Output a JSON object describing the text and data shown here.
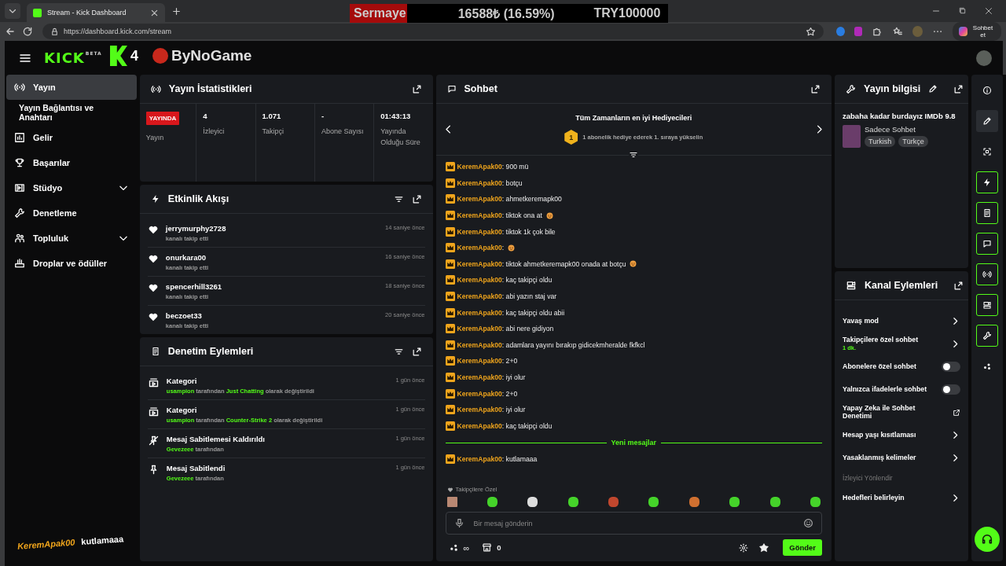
{
  "browser": {
    "tab_title": "Stream - Kick Dashboard",
    "url": "https://dashboard.kick.com/stream",
    "copilot_label": "Sohbet et"
  },
  "overlay": {
    "capital_label": "Sermaye",
    "capital_value": "16588₺ (16.59%)",
    "capital_target": "TRY100000",
    "level": 0.18,
    "logo_number": "4",
    "logo_text": "ByNoGame",
    "chat_user": "KeremApak00",
    "chat_text": "kutlamaaa"
  },
  "header": {
    "logo": "KICK",
    "logo_badge": "BETA"
  },
  "sidebar": {
    "items": [
      {
        "label": "Yayın",
        "kind": "broadcast",
        "selected": true,
        "expandable": false
      },
      {
        "label": "Yayın Bağlantısı ve Anahtarı",
        "kind": "subitem",
        "selected": false,
        "expandable": false
      },
      {
        "label": "Gelir",
        "kind": "chart",
        "selected": false,
        "expandable": false
      },
      {
        "label": "Başarılar",
        "kind": "trophy",
        "selected": false,
        "expandable": false
      },
      {
        "label": "Stüdyo",
        "kind": "film",
        "selected": false,
        "expandable": true
      },
      {
        "label": "Denetleme",
        "kind": "wrench",
        "selected": false,
        "expandable": false
      },
      {
        "label": "Topluluk",
        "kind": "people",
        "selected": false,
        "expandable": true
      },
      {
        "label": "Droplar ve ödüller",
        "kind": "gift",
        "selected": false,
        "expandable": false
      }
    ]
  },
  "stats": {
    "title": "Yayın İstatistikleri",
    "live_badge": "YAYINDA",
    "live_label": "Yayın",
    "items": [
      {
        "value": "4",
        "label": "İzleyici"
      },
      {
        "value": "1.071",
        "label": "Takipçi"
      },
      {
        "value": "-",
        "label": "Abone Sayısı"
      },
      {
        "value": "01:43:13",
        "label": "Yayında Olduğu Süre"
      }
    ]
  },
  "activity": {
    "title": "Etkinlik Akışı",
    "items": [
      {
        "user": "jerrymurphy2728",
        "action": "kanalı takip etti",
        "time": "14 saniye önce"
      },
      {
        "user": "onurkara00",
        "action": "kanalı takip etti",
        "time": "16 saniye önce"
      },
      {
        "user": "spencerhill3261",
        "action": "kanalı takip etti",
        "time": "18 saniye önce"
      },
      {
        "user": "beczoet33",
        "action": "kanalı takip etti",
        "time": "20 saniye önce"
      }
    ]
  },
  "moderation": {
    "title": "Denetim Eylemleri",
    "items": [
      {
        "kind": "category",
        "title": "Kategori",
        "detail": "**usampion** tarafından **Just Chatting** olarak değiştirildi",
        "time": "1 gün önce"
      },
      {
        "kind": "category",
        "title": "Kategori",
        "detail": "**usampion** tarafından **Counter-Strike 2** olarak değiştirildi",
        "time": "1 gün önce"
      },
      {
        "kind": "unpin",
        "title": "Mesaj Sabitlemesi Kaldırıldı",
        "detail": "**Gevezeee** tarafından",
        "time": "1 gün önce"
      },
      {
        "kind": "pin",
        "title": "Mesaj Sabitlendi",
        "detail": "**Gevezeee** tarafından",
        "time": "1 gün önce"
      }
    ]
  },
  "chat": {
    "title": "Sohbet",
    "gifters_title": "Tüm Zamanların en iyi Hediyecileri",
    "gift_rank": "1",
    "gift_prompt": "1 abonelik hediye ederek 1. sıraya yükselin",
    "messages": [
      {
        "text": "**KeremApak00**: 900 mü",
        "emoji": false
      },
      {
        "text": "**KeremApak00**: botçu",
        "emoji": false
      },
      {
        "text": "**KeremApak00**: ahmetkeremapk00",
        "emoji": false
      },
      {
        "text": "**KeremApak00**: tiktok ona at",
        "emoji": true
      },
      {
        "text": "**KeremApak00**: tiktok 1k çok bile",
        "emoji": false
      },
      {
        "text": "**KeremApak00**:",
        "emoji": true
      },
      {
        "text": "**KeremApak00**: tiktok ahmetkeremapk00 onada at botçu",
        "emoji": true
      },
      {
        "text": "**KeremApak00**: kaç takipçi oldu",
        "emoji": false
      },
      {
        "text": "**KeremApak00**: abi yazın staj var",
        "emoji": false
      },
      {
        "text": "**KeremApak00**: kaç takipçi oldu abii",
        "emoji": false
      },
      {
        "text": "**KeremApak00**: abi nere gidiyon",
        "emoji": false
      },
      {
        "text": "**KeremApak00**: adamlara yayını bırakıp gidicekmheralde fkfkcl",
        "emoji": false
      },
      {
        "text": "**KeremApak00**: 2+0",
        "emoji": false
      },
      {
        "text": "**KeremApak00**: iyi olur",
        "emoji": false
      },
      {
        "text": "**KeremApak00**: 2+0",
        "emoji": false
      },
      {
        "text": "**KeremApak00**: iyi olur",
        "emoji": false
      },
      {
        "text": "**KeremApak00**: kaç takipçi oldu",
        "emoji": false
      }
    ],
    "new_label": "Yeni mesajlar",
    "new_messages": [
      {
        "text": "**KeremApak00**: kutlamaaa",
        "emoji": false
      }
    ],
    "emote_group": "Takipçilere Özel",
    "placeholder": "Bir mesaj gönderin",
    "points": "∞",
    "shop_count": "0",
    "send": "Gönder"
  },
  "stream_info": {
    "title": "Yayın bilgisi",
    "stream_title": "zabaha kadar burdayız IMDb 9.8",
    "category": "Sadece Sohbet",
    "tags": [
      "Turkish",
      "Türkçe"
    ]
  },
  "channel_actions": {
    "title": "Kanal Eylemleri",
    "items": [
      {
        "kind": "link",
        "label": "Yavaş mod"
      },
      {
        "kind": "link",
        "label": "Takipçilere özel sohbet",
        "detail": "1 dk."
      },
      {
        "kind": "toggle",
        "label": "Abonelere özel sohbet",
        "on": false
      },
      {
        "kind": "toggle",
        "label": "Yalnızca ifadelerle sohbet",
        "on": false
      },
      {
        "kind": "external",
        "label": "Yapay Zeka ile Sohbet Denetimi"
      },
      {
        "kind": "link",
        "label": "Hesap yaşı kısıtlaması"
      },
      {
        "kind": "link",
        "label": "Yasaklanmış kelimeler"
      },
      {
        "kind": "section",
        "label": "İzleyici Yönlendir"
      },
      {
        "kind": "link",
        "label": "Hedefleri belirleyin"
      }
    ]
  },
  "rail": [
    {
      "kind": "info",
      "selected": false,
      "on": false
    },
    {
      "kind": "pencil",
      "selected": true,
      "on": false
    },
    {
      "kind": "capture",
      "selected": false,
      "on": false
    },
    {
      "kind": "bolt",
      "selected": false,
      "on": true
    },
    {
      "kind": "notes",
      "selected": false,
      "on": true
    },
    {
      "kind": "chat",
      "selected": false,
      "on": true
    },
    {
      "kind": "broadcast",
      "selected": false,
      "on": true
    },
    {
      "kind": "camera",
      "selected": false,
      "on": true
    },
    {
      "kind": "wrench",
      "selected": false,
      "on": true
    },
    {
      "kind": "dots",
      "selected": false,
      "on": false
    }
  ]
}
